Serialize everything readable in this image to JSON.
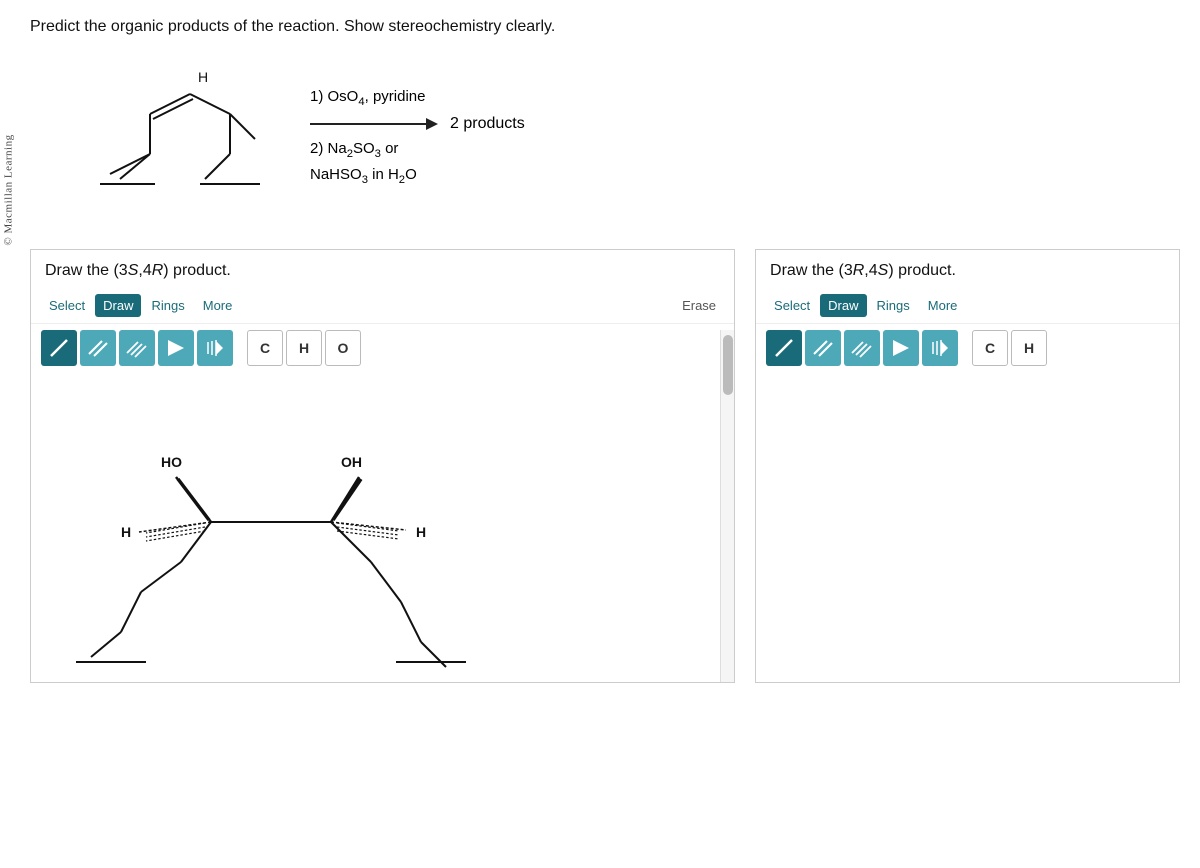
{
  "copyright": "© Macmillan Learning",
  "question": {
    "text": "Predict the organic products of the reaction. Show stereochemistry clearly."
  },
  "reaction": {
    "step1": "1) OsO",
    "step1_sub": "4",
    "step1_rest": ", pyridine",
    "step2": "2) Na",
    "step2_sub1": "2",
    "step2_rest1": "SO",
    "step2_sub2": "3",
    "step2_or": " or",
    "step3": "NaHSO",
    "step3_sub": "3",
    "step3_rest": " in H",
    "step3_sub2": "2",
    "step3_rest2": "O",
    "products_label": "2 products"
  },
  "panel_left": {
    "title": "Draw the (3S,4R) product.",
    "toolbar": {
      "select_label": "Select",
      "draw_label": "Draw",
      "rings_label": "Rings",
      "more_label": "More",
      "erase_label": "Erase"
    },
    "draw_tools": {
      "single_bond": "/",
      "double_bond": "//",
      "triple_bond": "///",
      "wedge": "▶",
      "dash": "◀",
      "carbon": "C",
      "hydrogen": "H",
      "oxygen": "O"
    }
  },
  "panel_right": {
    "title": "Draw the (3R,4S) product.",
    "toolbar": {
      "select_label": "Select",
      "draw_label": "Draw",
      "rings_label": "Rings",
      "more_label": "More"
    },
    "draw_tools": {
      "single_bond": "/",
      "double_bond": "//",
      "triple_bond": "///",
      "wedge": "▶",
      "dash": "◀",
      "carbon": "C",
      "hydrogen": "H"
    }
  }
}
